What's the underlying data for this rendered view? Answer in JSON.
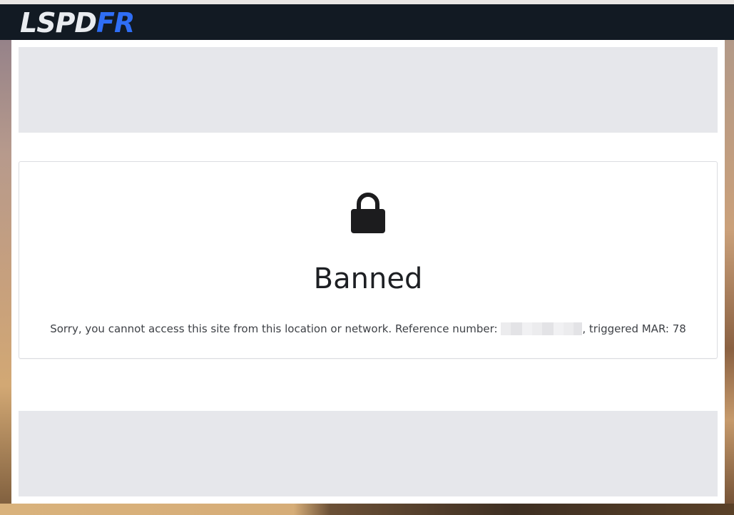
{
  "header": {
    "logo_part1": "LSPD",
    "logo_part2": "FR"
  },
  "ban_card": {
    "icon": "lock-icon",
    "title": "Banned",
    "message_prefix": "Sorry, you cannot access this site from this location or network. Reference number: ",
    "message_suffix": ", triggered MAR: 78"
  },
  "colors": {
    "header_bg": "#121a23",
    "logo_white": "#e9ecf0",
    "logo_blue": "#2f6ef5",
    "ad_placeholder": "#e6e7eb",
    "text_dark": "#1d1f23"
  }
}
